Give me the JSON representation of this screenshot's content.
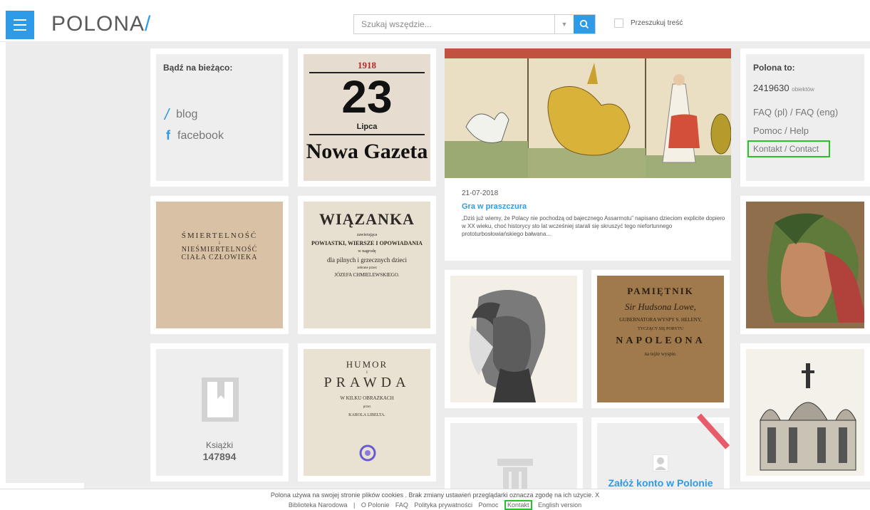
{
  "header": {
    "menu_icon": "hamburger-icon",
    "logo_text": "POLONA",
    "logo_slash": "/",
    "search_placeholder": "Szukaj wszędzie...",
    "search_icon": "search-icon",
    "dropdown_icon": "chevron-down-icon",
    "fulltext_label": "Przeszukuj treść"
  },
  "news_tile": {
    "title": "Bądź na bieżąco:",
    "links": [
      {
        "icon": "slash",
        "label": "blog"
      },
      {
        "icon": "f",
        "label": "facebook"
      }
    ]
  },
  "info_tile": {
    "title": "Polona to:",
    "count": "2419630",
    "count_unit": "obiektów",
    "faq": "FAQ (pl) / FAQ (eng)",
    "help": "Pomoc / Help",
    "contact": "Kontakt / Contact"
  },
  "gazette": {
    "year": "1918",
    "day": "23",
    "month": "Lipca",
    "name": "Nowa Gazeta"
  },
  "article": {
    "date": "21-07-2018",
    "title": "Gra w praszczura",
    "excerpt": "„Dziś już wiemy, że Polacy nie pochodzą od bajecznego Assarmotu” napisano dzieciom explicite dopiero w XX wieku, choć historycy sto lat wcześniej starali się skruszyć tego niefortunnego prototurbosłowiańskiego bałwana..."
  },
  "book1": {
    "l1": "ŚMIERTELNOŚĆ",
    "l2": "i",
    "l3": "NIEŚMIERTELNOŚĆ",
    "l4": "CIAŁA CZŁOWIEKA"
  },
  "book2": {
    "l1": "WIĄZANKA",
    "l2": "zawierająca",
    "l3": "POWIASTKI, WIERSZE I OPOWIADANIA",
    "l4": "w nagrodę",
    "l5": "dla pilnych i grzecznych dzieci",
    "l6": "zebrane przez",
    "l7": "JÓZEFA CHMIELEWSKIEGO."
  },
  "book3": {
    "l1": "HUMOR",
    "l2": "i",
    "l3": "PRAWDA",
    "l4": "W KILKU OBRAZKACH",
    "l5": "przez",
    "l6": "KAROLA LIBELTA."
  },
  "book4": {
    "l1": "PAMIĘTNIK",
    "l2": "Sir Hudsona Lowe,",
    "l3": "GUBERNATORA WYSPY S. HELENY,",
    "l4": "TYCZĄCY SIĘ POBYTU",
    "l5": "NAPOLEONA",
    "l6": "na tejże wyspie."
  },
  "books_tile": {
    "label": "Książki",
    "count": "147894",
    "icon": "book-bookmark-icon"
  },
  "account_tile": {
    "label": "Załóż konto w Polonie",
    "icon": "user-avatar-icon"
  },
  "cookie_bar": {
    "text": "Polona używa na swojej stronie plików cookies . Brak zmiany ustawień przeglądarki oznacza zgodę na ich użycie. X",
    "footer": [
      "Biblioteka Narodowa",
      "|",
      "O Polonie",
      "FAQ",
      "Polityka prywatności",
      "Pomoc",
      "Kontakt",
      "English version"
    ]
  },
  "colors": {
    "accent": "#2d9be8",
    "highlight": "#2bc12b",
    "tile_bg": "#eeeeee"
  }
}
